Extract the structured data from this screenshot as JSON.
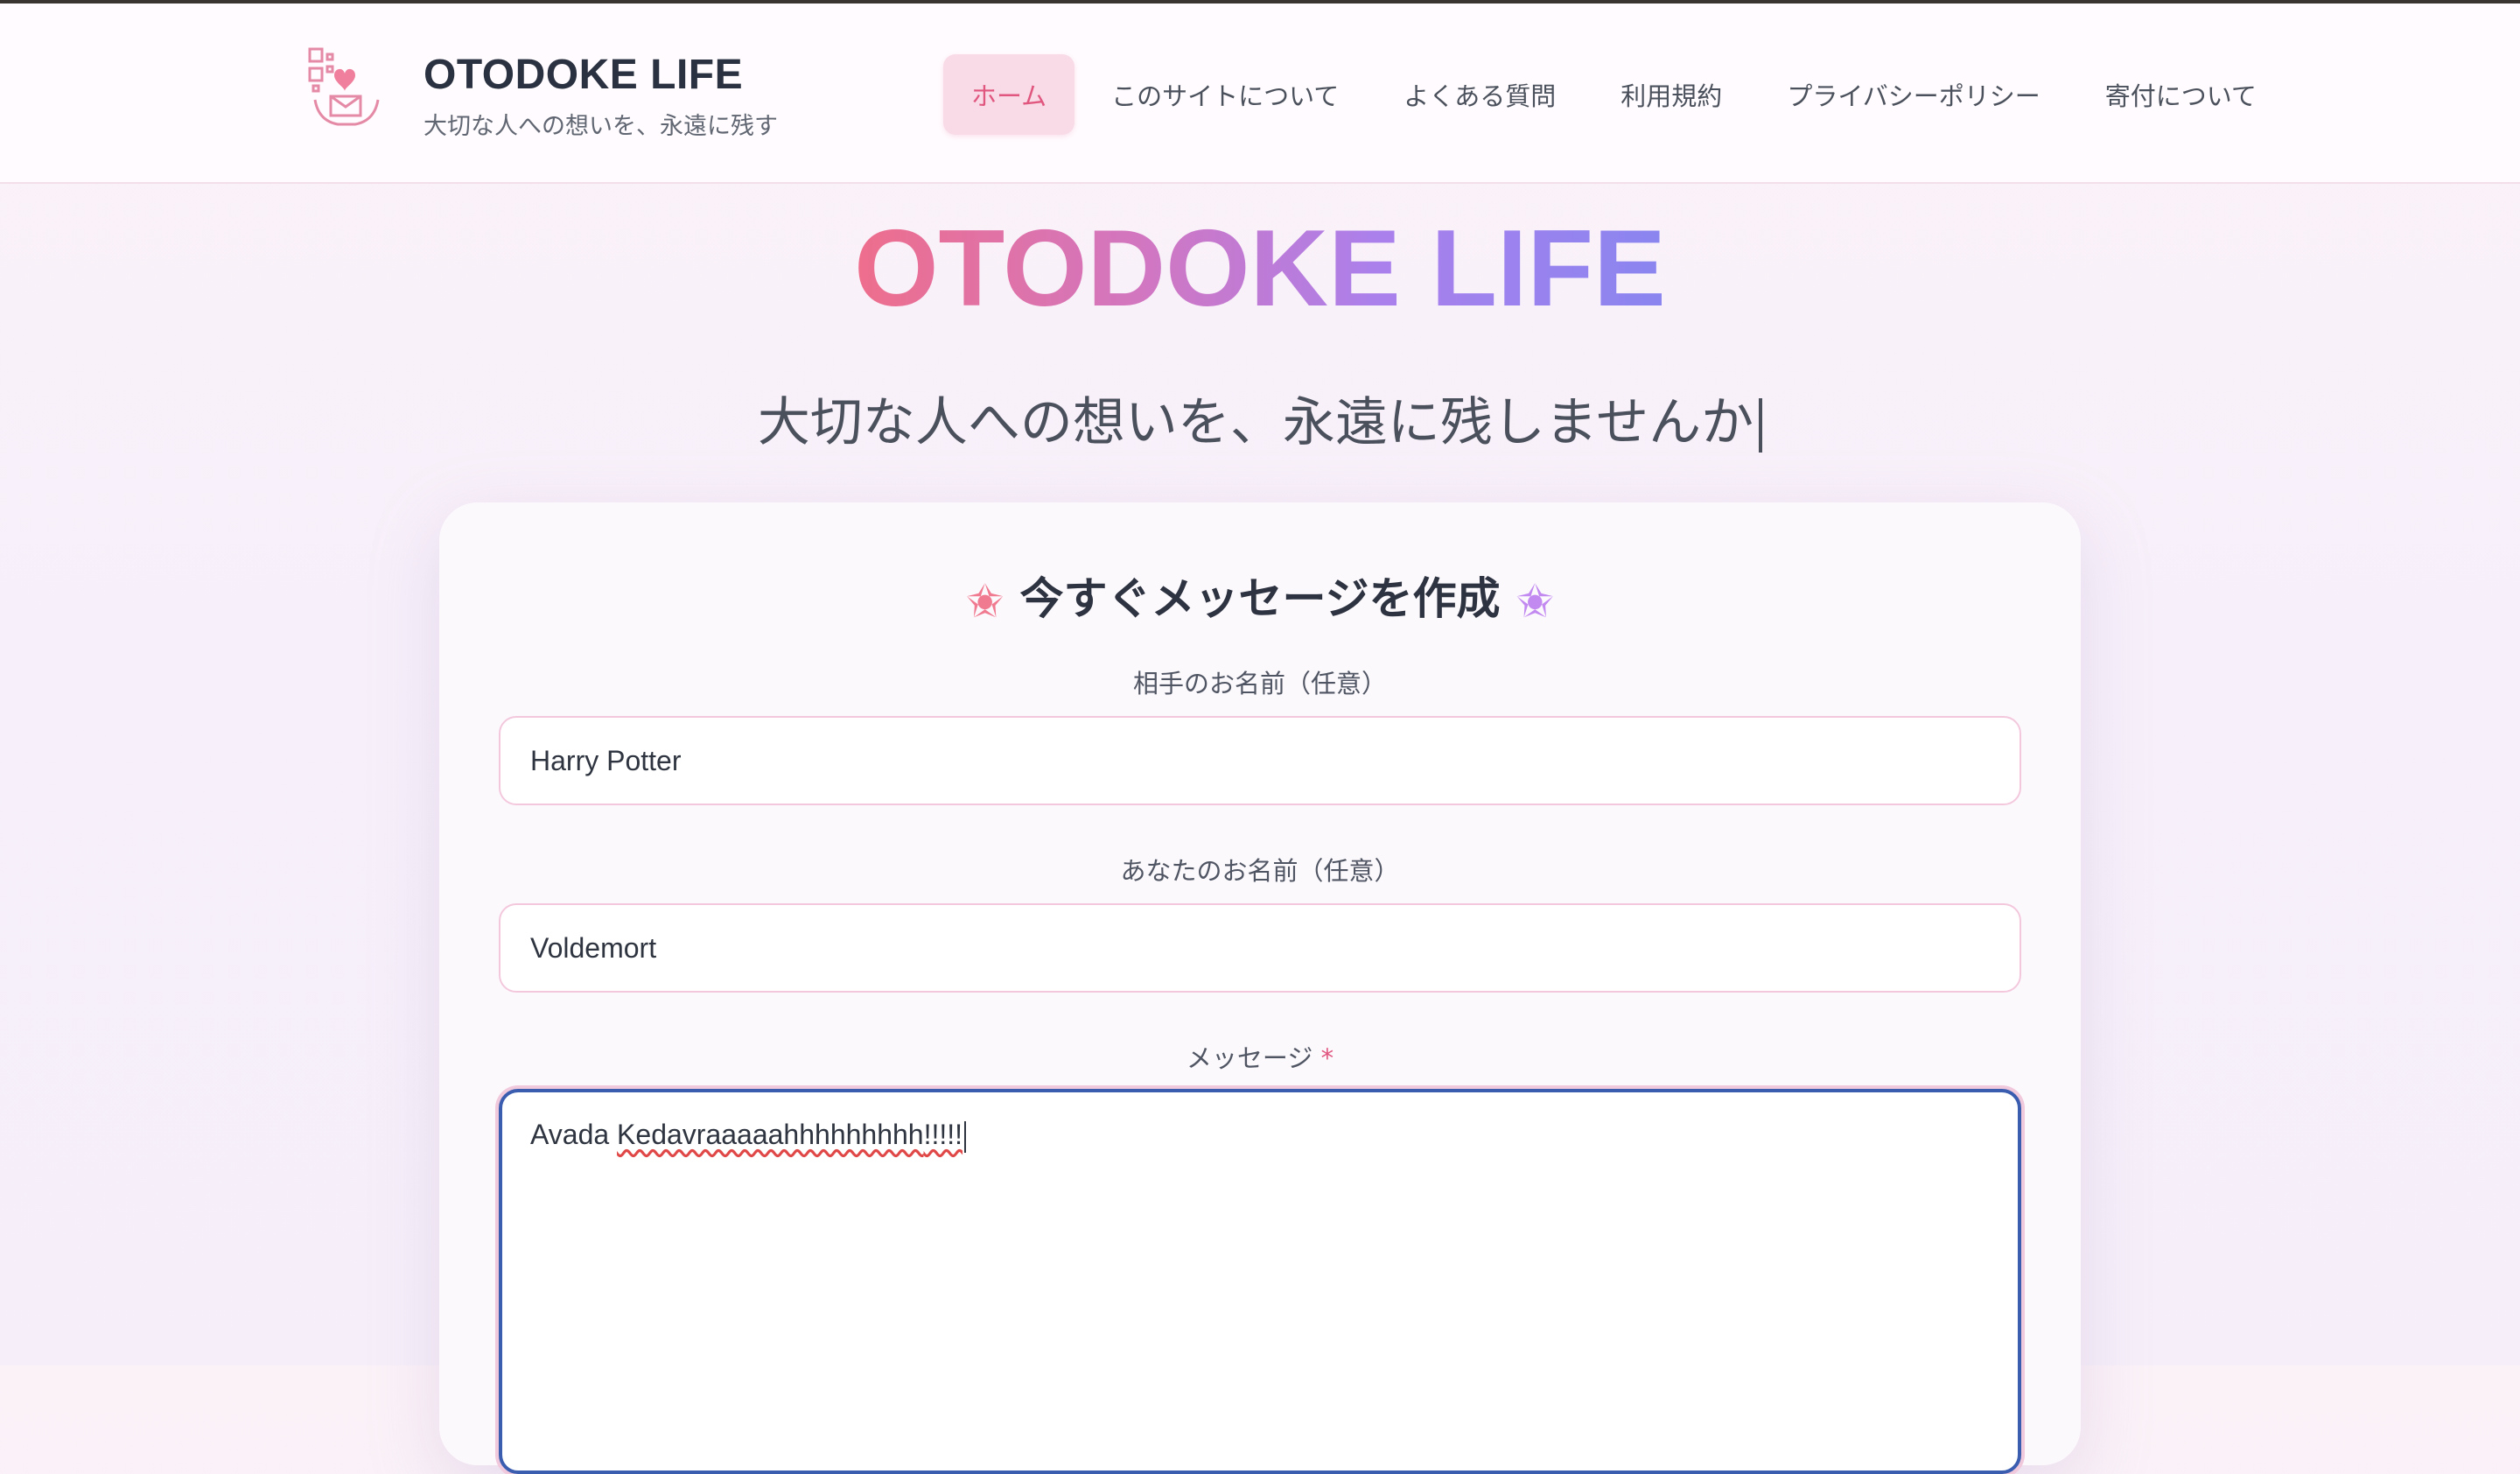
{
  "header": {
    "brand_title": "OTODOKE LIFE",
    "brand_subtitle": "大切な人への想いを、永遠に残す",
    "nav": [
      {
        "label": "ホーム",
        "active": true
      },
      {
        "label": "このサイトについて",
        "active": false
      },
      {
        "label": "よくある質問",
        "active": false
      },
      {
        "label": "利用規約",
        "active": false
      },
      {
        "label": "プライバシーポリシー",
        "active": false
      },
      {
        "label": "寄付について",
        "active": false
      }
    ]
  },
  "hero": {
    "title": "OTODOKE LIFE",
    "subtitle": "大切な人への想いを、永遠に残しませんか"
  },
  "form": {
    "title": "今すぐメッセージを作成",
    "recipient": {
      "label": "相手のお名前（任意）",
      "value": "Harry Potter"
    },
    "sender": {
      "label": "あなたのお名前（任意）",
      "value": "Voldemort"
    },
    "message": {
      "label": "メッセージ",
      "required_mark": "*",
      "value_word1": "Avada",
      "value_word2": "Kedavraaaaahhhhhhhhh",
      "value_tail": "!!!!!"
    }
  },
  "colors": {
    "accent_pink": "#e0567f",
    "gradient_start": "#ee6e8c",
    "gradient_end": "#8a85f0",
    "focus_border": "#3a5db0"
  },
  "icons": {
    "logo": "qr-heart-envelope-hands-icon",
    "title_left": "sparkle-star-icon",
    "title_right": "sparkle-star-icon"
  }
}
